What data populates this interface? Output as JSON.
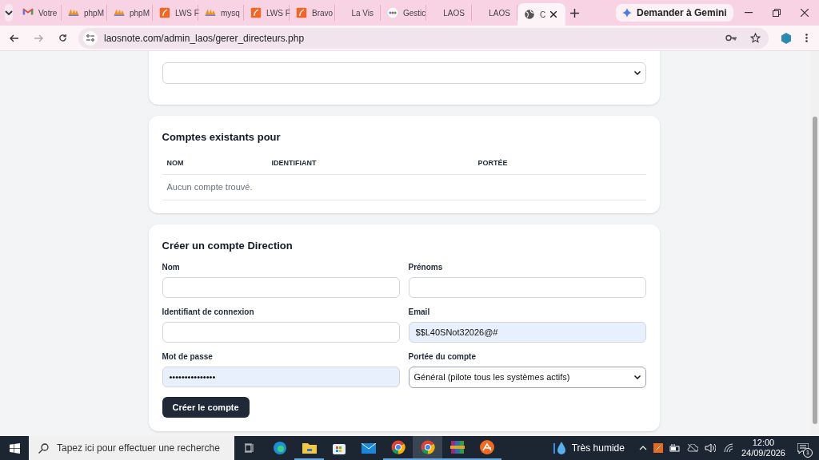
{
  "browser": {
    "tabs": [
      {
        "kind": "gmail",
        "label": "Votre",
        "selected": false
      },
      {
        "kind": "pma",
        "label": "phpM",
        "selected": false
      },
      {
        "kind": "pma",
        "label": "phpM",
        "selected": false
      },
      {
        "kind": "lws",
        "label": "LWS F",
        "selected": false
      },
      {
        "kind": "pma",
        "label": "mysq",
        "selected": false
      },
      {
        "kind": "lws",
        "label": "LWS F",
        "selected": false
      },
      {
        "kind": "lws",
        "label": "Bravo",
        "selected": false
      },
      {
        "kind": "none",
        "label": "La Vis",
        "selected": false
      },
      {
        "kind": "google",
        "label": "Gestic",
        "selected": false
      },
      {
        "kind": "none",
        "label": "LAOS",
        "selected": false
      },
      {
        "kind": "none",
        "label": "LAOS",
        "selected": false
      },
      {
        "kind": "globe",
        "label": "C",
        "selected": true
      }
    ],
    "gemini_button": "Demander à Gemini",
    "url": "laosnote.com/admin_laos/gerer_directeurs.php"
  },
  "accounts": {
    "title": "Comptes existants pour",
    "columns": [
      "NOM",
      "IDENTIFIANT",
      "PORTÉE"
    ],
    "empty_message": "Aucun compte trouvé."
  },
  "create_form": {
    "title": "Créer un compte Direction",
    "fields": [
      {
        "kind": "input",
        "label": "Nom",
        "autofilled": false
      },
      {
        "kind": "input",
        "label": "Prénoms",
        "autofilled": false
      },
      {
        "kind": "input",
        "label": "Identifiant de connexion",
        "autofilled": false
      },
      {
        "kind": "input",
        "label": "Email",
        "value": "$$L40SNot32026@#",
        "autofilled": true
      },
      {
        "kind": "input",
        "label": "Mot de passe",
        "value": "•••••••••••••••",
        "autofilled": true
      },
      {
        "kind": "select",
        "label": "Portée du compte",
        "value": "Général (pilote tous les systèmes actifs)",
        "autofilled": false
      }
    ],
    "submit": "Créer le compte"
  },
  "taskbar": {
    "search_placeholder": "Tapez ici pour effectuer une recherche",
    "weather": "Très humide",
    "time": "12:00",
    "date": "24/09/2026",
    "notification_count": "1"
  }
}
